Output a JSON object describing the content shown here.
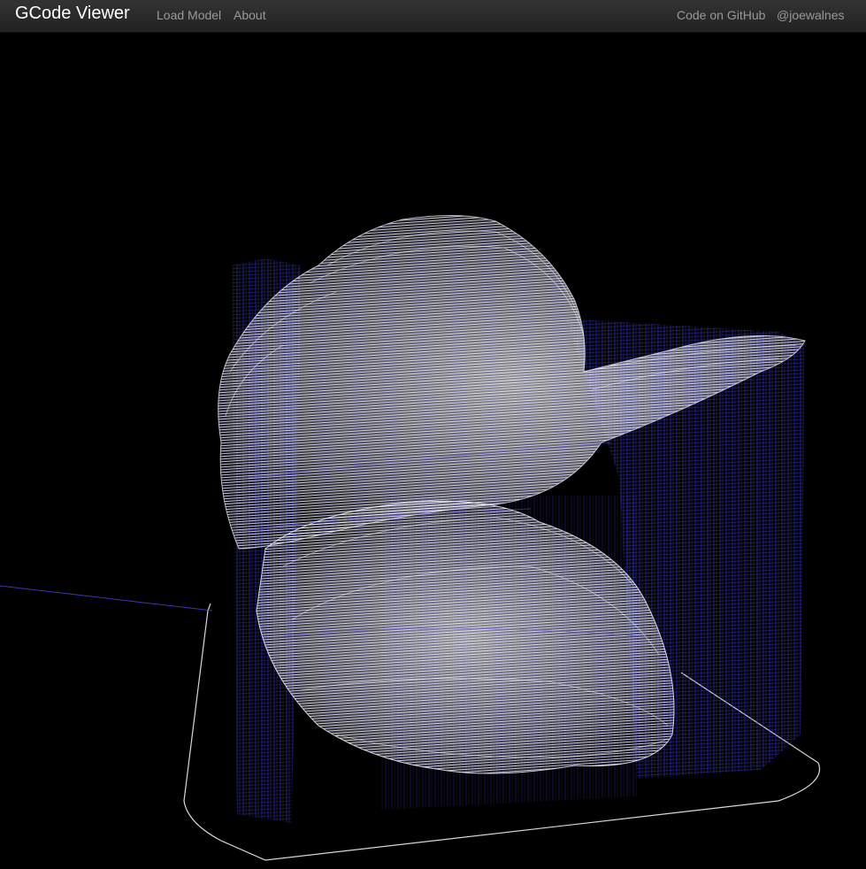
{
  "navbar": {
    "brand": "GCode Viewer",
    "links": [
      {
        "label": "Load Model"
      },
      {
        "label": "About"
      }
    ],
    "right_links": [
      {
        "label": "Code on GitHub"
      },
      {
        "label": "@joewalnes"
      }
    ]
  },
  "colors": {
    "navbar_bg": "#2c2c2c",
    "brand_text": "#ffffff",
    "nav_text": "#999999",
    "canvas_bg": "#000000",
    "toolpath_extrude": "#ffffff",
    "toolpath_move": "#3a3aff"
  },
  "viewer": {
    "content": "3D rendered G-code toolpath model"
  }
}
